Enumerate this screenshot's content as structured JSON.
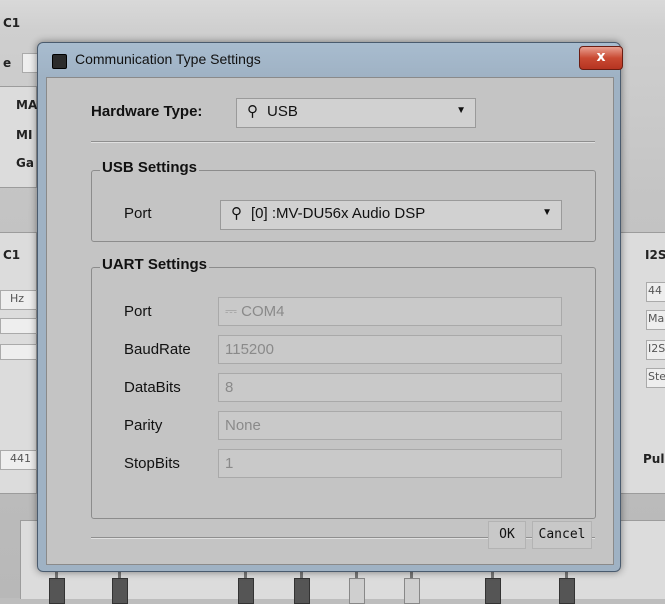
{
  "background": {
    "title_fragment": "C1",
    "row_label_fragment": "e",
    "left_labels": [
      "MA",
      "MI",
      "Ga"
    ],
    "left_mid_label": "C1",
    "left_field_fragment": "Hz",
    "left_bottom_field": "441",
    "right_labels": [
      "I2S"
    ],
    "right_fields": [
      "44",
      "Ma",
      "I2S",
      "Ste"
    ],
    "right_bottom_label": "Pul"
  },
  "dialog": {
    "title": "Communication Type Settings",
    "close_label": "x",
    "hardware_type_label": "Hardware Type:",
    "hardware_type_value": "USB",
    "usb_group": {
      "title": "USB Settings",
      "port_label": "Port",
      "port_value": "[0] :MV-DU56x Audio DSP"
    },
    "uart_group": {
      "title": "UART Settings",
      "port_label": "Port",
      "port_value": "COM4",
      "baudrate_label": "BaudRate",
      "baudrate_value": "115200",
      "databits_label": "DataBits",
      "databits_value": "8",
      "parity_label": "Parity",
      "parity_value": "None",
      "stopbits_label": "StopBits",
      "stopbits_value": "1"
    },
    "ok_label": "OK",
    "cancel_label": "Cancel"
  },
  "icons": {
    "usb": "usb-icon",
    "com_port": "serial-port-icon",
    "dropdown": "chevron-down-icon"
  },
  "colors": {
    "title_bar": "#a8bccf",
    "close_button": "#c94a33",
    "dialog_body": "#c4c4c4"
  }
}
